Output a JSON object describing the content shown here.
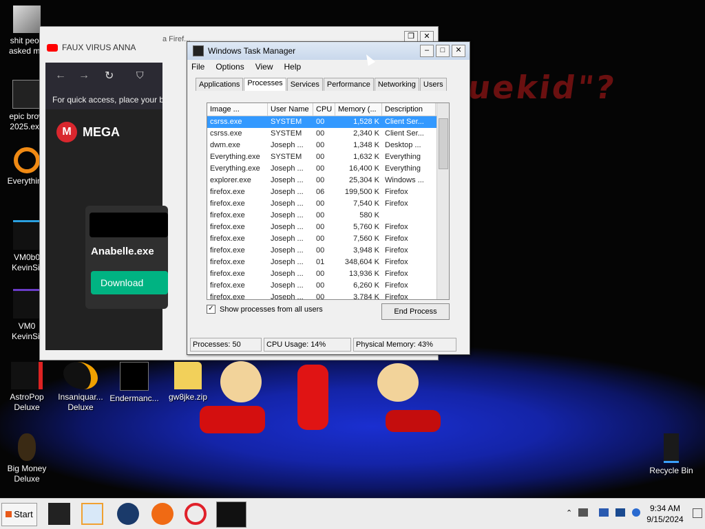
{
  "desktop": {
    "background_text": "uekid\"?",
    "icons": [
      {
        "label": "shit peop\nasked me"
      },
      {
        "label": "epic brow\n2025.exe"
      },
      {
        "label": "Everything"
      },
      {
        "label": "VM0b0\nKevinSit"
      },
      {
        "label": "VM0\nKevinSi."
      },
      {
        "label": "AstroPop\nDeluxe"
      },
      {
        "label": "Insaniquar...\nDeluxe"
      },
      {
        "label": "Endermanc..."
      },
      {
        "label": "gw8jke.zip"
      },
      {
        "label": "Big Money\nDeluxe"
      },
      {
        "label": "Recycle Bin"
      }
    ]
  },
  "firefox": {
    "tab_title": "FAUX VIRUS ANNA",
    "title_fragment": "a Firef...",
    "bookmarks_hint": "For quick access, place your bo",
    "site_name": "MEGA",
    "file_name": "Anabelle.exe",
    "download_label": "Download"
  },
  "taskmgr": {
    "title": "Windows Task Manager",
    "menu": [
      "File",
      "Options",
      "View",
      "Help"
    ],
    "tabs": [
      "Applications",
      "Processes",
      "Services",
      "Performance",
      "Networking",
      "Users"
    ],
    "active_tab": "Processes",
    "columns": [
      "Image ...",
      "User Name",
      "CPU",
      "Memory (...",
      "Description"
    ],
    "rows": [
      {
        "image": "csrss.exe",
        "user": "SYSTEM",
        "cpu": "00",
        "mem": "1,528 K",
        "desc": "Client Ser..."
      },
      {
        "image": "csrss.exe",
        "user": "SYSTEM",
        "cpu": "00",
        "mem": "2,340 K",
        "desc": "Client Ser..."
      },
      {
        "image": "dwm.exe",
        "user": "Joseph ...",
        "cpu": "00",
        "mem": "1,348 K",
        "desc": "Desktop ..."
      },
      {
        "image": "Everything.exe",
        "user": "SYSTEM",
        "cpu": "00",
        "mem": "1,632 K",
        "desc": "Everything"
      },
      {
        "image": "Everything.exe",
        "user": "Joseph ...",
        "cpu": "00",
        "mem": "16,400 K",
        "desc": "Everything"
      },
      {
        "image": "explorer.exe",
        "user": "Joseph ...",
        "cpu": "00",
        "mem": "25,304 K",
        "desc": "Windows ..."
      },
      {
        "image": "firefox.exe",
        "user": "Joseph ...",
        "cpu": "06",
        "mem": "199,500 K",
        "desc": "Firefox"
      },
      {
        "image": "firefox.exe",
        "user": "Joseph ...",
        "cpu": "00",
        "mem": "7,540 K",
        "desc": "Firefox"
      },
      {
        "image": "firefox.exe",
        "user": "Joseph ...",
        "cpu": "00",
        "mem": "580 K",
        "desc": ""
      },
      {
        "image": "firefox.exe",
        "user": "Joseph ...",
        "cpu": "00",
        "mem": "5,760 K",
        "desc": "Firefox"
      },
      {
        "image": "firefox.exe",
        "user": "Joseph ...",
        "cpu": "00",
        "mem": "7,560 K",
        "desc": "Firefox"
      },
      {
        "image": "firefox.exe",
        "user": "Joseph ...",
        "cpu": "00",
        "mem": "3,948 K",
        "desc": "Firefox"
      },
      {
        "image": "firefox.exe",
        "user": "Joseph ...",
        "cpu": "01",
        "mem": "348,604 K",
        "desc": "Firefox"
      },
      {
        "image": "firefox.exe",
        "user": "Joseph ...",
        "cpu": "00",
        "mem": "13,936 K",
        "desc": "Firefox"
      },
      {
        "image": "firefox.exe",
        "user": "Joseph ...",
        "cpu": "00",
        "mem": "6,260 K",
        "desc": "Firefox"
      },
      {
        "image": "firefox.exe",
        "user": "Joseph ...",
        "cpu": "00",
        "mem": "3,784 K",
        "desc": "Firefox"
      }
    ],
    "show_all_label": "Show processes from all users",
    "show_all_checked": true,
    "end_process_label": "End Process",
    "status": {
      "processes": "Processes: 50",
      "cpu": "CPU Usage: 14%",
      "memory": "Physical Memory: 43%"
    }
  },
  "taskbar": {
    "start_label": "Start",
    "time": "9:34 AM",
    "date": "9/15/2024"
  }
}
